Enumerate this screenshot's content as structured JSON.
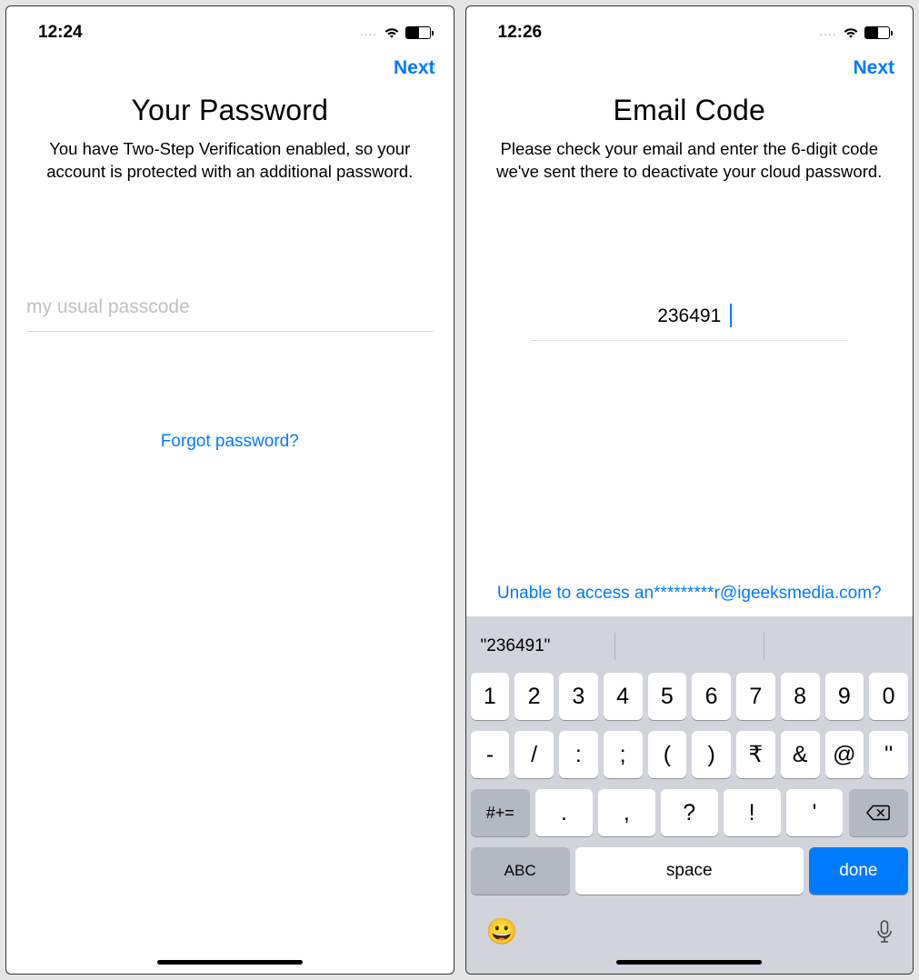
{
  "screens": {
    "left": {
      "status": {
        "time": "12:24",
        "battery": 55,
        "dots": "...."
      },
      "nav": {
        "next": "Next"
      },
      "title": "Your Password",
      "subtitle": "You have Two-Step Verification enabled, so your account is protected with an additional password.",
      "input": {
        "placeholder": "my usual passcode",
        "value": ""
      },
      "forgot": "Forgot password?"
    },
    "right": {
      "status": {
        "time": "12:26",
        "battery": 55,
        "dots": "...."
      },
      "nav": {
        "next": "Next"
      },
      "title": "Email Code",
      "subtitle": "Please check your email and enter the 6-digit code we've sent there to deactivate your cloud password.",
      "input": {
        "placeholder": "",
        "value": "236491"
      },
      "unable": "Unable to access an*********r@igeeksmedia.com?",
      "keyboard": {
        "suggestion": "\"236491\"",
        "row1": [
          "1",
          "2",
          "3",
          "4",
          "5",
          "6",
          "7",
          "8",
          "9",
          "0"
        ],
        "row2": [
          "-",
          "/",
          ":",
          ";",
          "(",
          ")",
          "₹",
          "&",
          "@",
          "''"
        ],
        "shift": "#+=",
        "row3": [
          ".",
          ",",
          "?",
          "!",
          "'"
        ],
        "abc": "ABC",
        "space": "space",
        "done": "done"
      }
    }
  }
}
